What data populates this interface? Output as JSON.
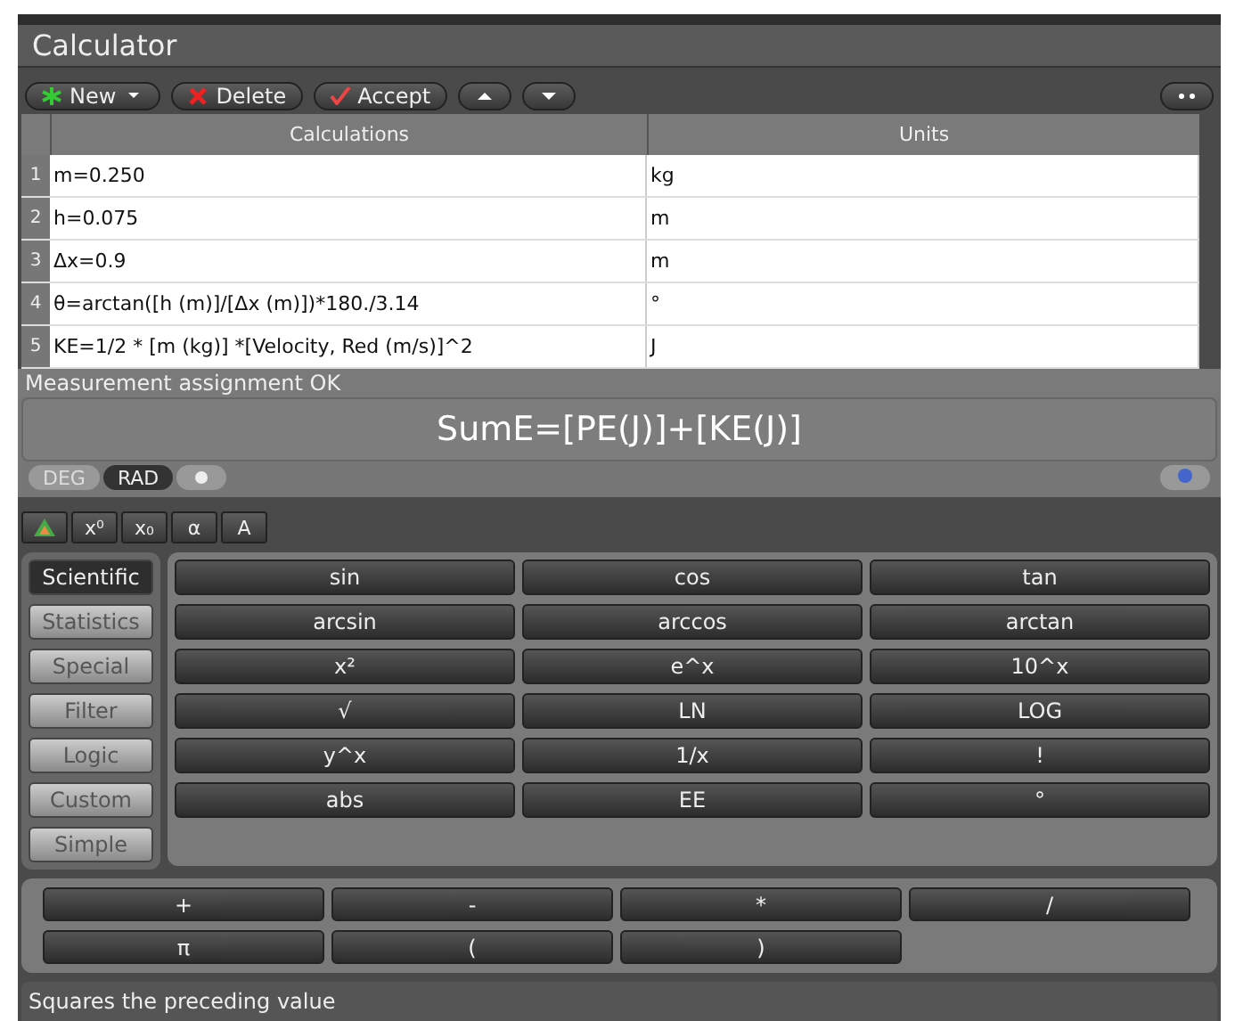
{
  "window": {
    "title": "Calculator"
  },
  "toolbar": {
    "buttons": [
      {
        "label": "New",
        "kind": "new"
      },
      {
        "label": "Delete",
        "kind": "delete"
      },
      {
        "label": "Accept",
        "kind": "accept"
      },
      {
        "kind": "up"
      },
      {
        "kind": "down"
      }
    ]
  },
  "table": {
    "columns": [
      "Calculations",
      "Units"
    ],
    "rows": [
      {
        "number": "1",
        "calculation": "m=0.250",
        "unit": "kg"
      },
      {
        "number": "2",
        "calculation": "h=0.075",
        "unit": "m"
      },
      {
        "number": "3",
        "calculation": "Δx=0.9",
        "unit": "m"
      },
      {
        "number": "4",
        "calculation": "θ=arctan([h (m)]/[Δx (m)])*180./3.14",
        "unit": "°"
      },
      {
        "number": "5",
        "calculation": "KE=1/2 * [m (kg)] *[Velocity, Red (m/s)]^2",
        "unit": "J"
      }
    ]
  },
  "message": "Measurement assignment OK",
  "formula": "SumE=[PE(J)]+[KE(J)]",
  "angle_modes": [
    {
      "label": "DEG",
      "selected": false
    },
    {
      "label": "RAD",
      "selected": true
    }
  ],
  "format_buttons": [
    "x⁰",
    "x₀",
    "α",
    "A"
  ],
  "categories": [
    {
      "label": "Scientific",
      "selected": true
    },
    {
      "label": "Statistics",
      "selected": false
    },
    {
      "label": "Special",
      "selected": false
    },
    {
      "label": "Filter",
      "selected": false
    },
    {
      "label": "Logic",
      "selected": false
    },
    {
      "label": "Custom",
      "selected": false
    },
    {
      "label": "Simple",
      "selected": false
    }
  ],
  "functions": [
    [
      "sin",
      "cos",
      "tan"
    ],
    [
      "arcsin",
      "arccos",
      "arctan"
    ],
    [
      "x²",
      "e^x",
      "10^x"
    ],
    [
      "√",
      "LN",
      "LOG"
    ],
    [
      "y^x",
      "1/x",
      "!"
    ],
    [
      "abs",
      "EE",
      "°"
    ]
  ],
  "operators": [
    "+",
    "-",
    "*",
    "/",
    "π",
    "(",
    ")"
  ],
  "status_bar": "Squares the preceding value"
}
